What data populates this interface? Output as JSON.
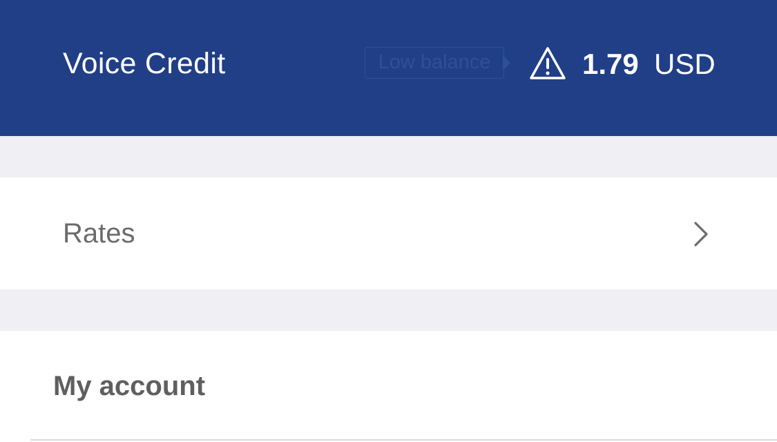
{
  "header": {
    "title": "Voice Credit",
    "low_balance_label": "Low balance",
    "warning_icon": "warning-triangle-icon",
    "balance_amount": "1.79",
    "balance_currency": "USD",
    "background_color": "#213f87"
  },
  "menu": {
    "rates_label": "Rates",
    "rates_chevron_icon": "chevron-right-icon",
    "account_section_label": "My account"
  }
}
